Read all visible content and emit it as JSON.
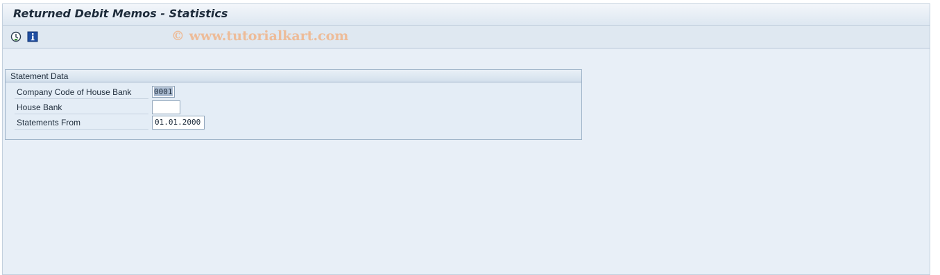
{
  "window": {
    "title": "Returned Debit Memos - Statistics"
  },
  "toolbar": {
    "items": [
      {
        "icon": "execute-icon",
        "label": "Execute"
      },
      {
        "icon": "info-icon",
        "label": "Information"
      }
    ],
    "watermark": "© www.tutorialkart.com"
  },
  "statement_data": {
    "title": "Statement Data",
    "fields": [
      {
        "label": "Company Code of House Bank",
        "value": "0001"
      },
      {
        "label": "House Bank",
        "value": ""
      },
      {
        "label": "Statements From",
        "value": "01.01.2000"
      }
    ]
  },
  "colors": {
    "background": "#e8eff7",
    "title_text": "#1d2b3a",
    "watermark": "#f0b58a",
    "selection": "#a8b9cf"
  }
}
